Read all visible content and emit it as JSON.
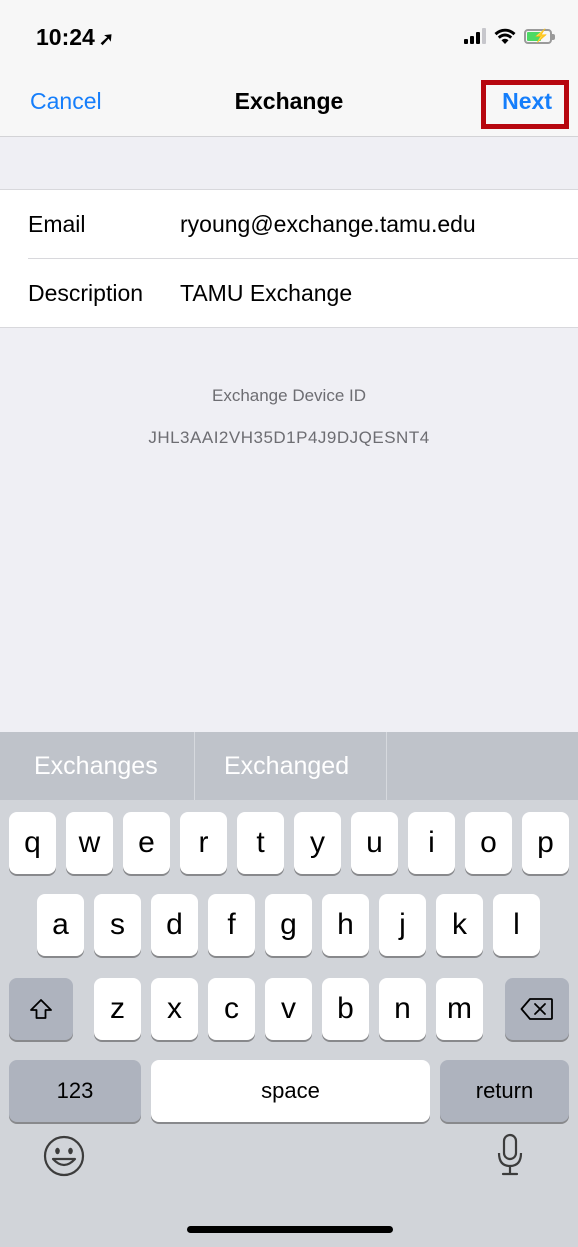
{
  "status": {
    "time": "10:24",
    "location_icon": "location-arrow-icon",
    "signal_icon": "cellular-signal-icon",
    "wifi_icon": "wifi-icon",
    "battery_icon": "battery-charging-icon"
  },
  "nav": {
    "cancel_label": "Cancel",
    "title": "Exchange",
    "next_label": "Next",
    "accent_color": "#157efb",
    "highlight_color": "#b7070f"
  },
  "form": {
    "email": {
      "label": "Email",
      "value": "ryoung@exchange.tamu.edu"
    },
    "description": {
      "label": "Description",
      "value": "TAMU Exchange"
    }
  },
  "device": {
    "label": "Exchange Device ID",
    "value": "JHL3AAI2VH35D1P4J9DJQESNT4"
  },
  "keyboard": {
    "suggestions": [
      "Exchanges",
      "Exchanged",
      ""
    ],
    "row1": [
      "q",
      "w",
      "e",
      "r",
      "t",
      "y",
      "u",
      "i",
      "o",
      "p"
    ],
    "row2": [
      "a",
      "s",
      "d",
      "f",
      "g",
      "h",
      "j",
      "k",
      "l"
    ],
    "row3": [
      "z",
      "x",
      "c",
      "v",
      "b",
      "n",
      "m"
    ],
    "shift_icon": "shift-icon",
    "delete_icon": "delete-icon",
    "numbers_label": "123",
    "space_label": "space",
    "return_label": "return",
    "emoji_icon": "emoji-icon",
    "mic_icon": "microphone-icon"
  }
}
